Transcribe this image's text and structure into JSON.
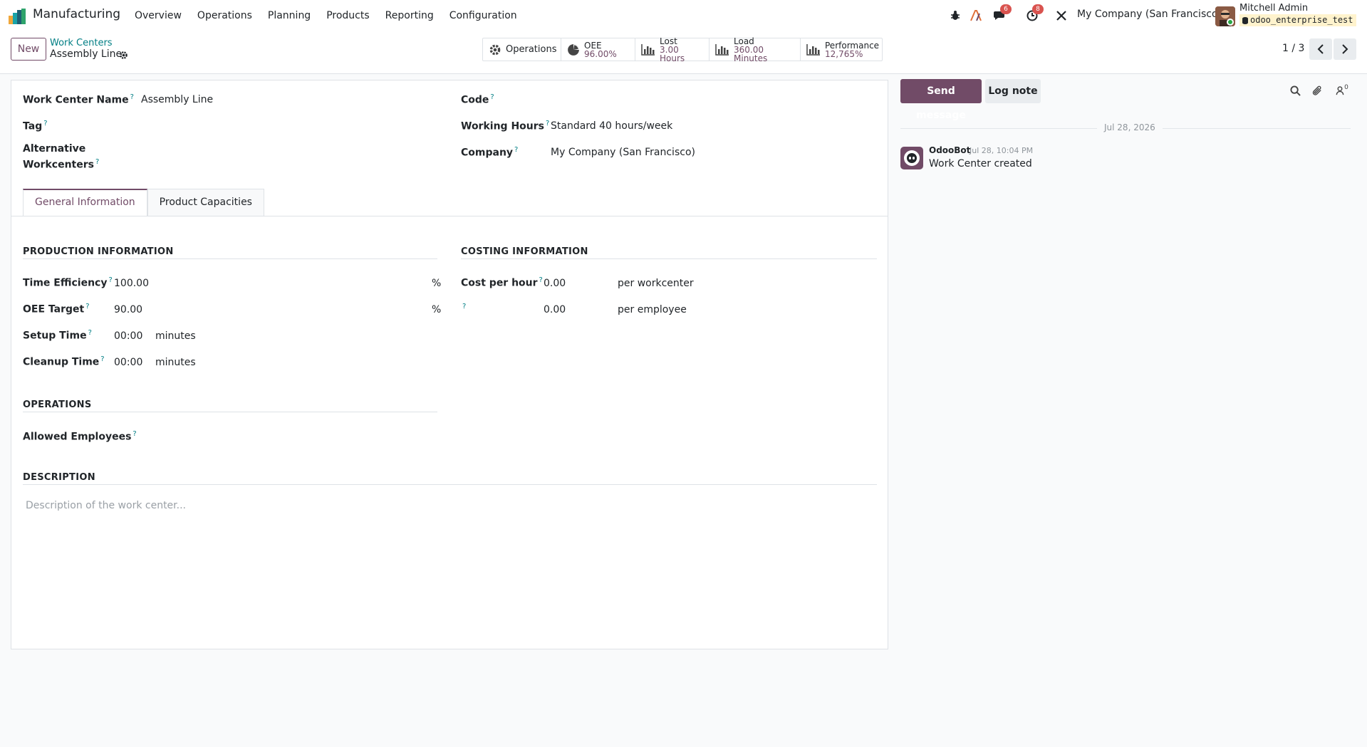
{
  "navbar": {
    "app_name": "Manufacturing",
    "menu": [
      "Overview",
      "Operations",
      "Planning",
      "Products",
      "Reporting",
      "Configuration"
    ],
    "discuss_count": "6",
    "activity_count": "8",
    "company": "My Company (San Francisco)",
    "user_name": "Mitchell Admin",
    "database": "odoo_enterprise_test"
  },
  "breadcrumb": {
    "new_label": "New",
    "parent": "Work Centers",
    "current": "Assembly Line"
  },
  "smart_buttons": {
    "operations": "Operations",
    "oee_label": "OEE",
    "oee_value": "96.00%",
    "lost_label": "Lost",
    "lost_value": "3.00 Hours",
    "load_label": "Load",
    "load_value": "360.00 Minutes",
    "performance_label": "Performance",
    "performance_value": "12,765%"
  },
  "pager": {
    "value": "1 / 3"
  },
  "form": {
    "work_center_name_label": "Work Center Name",
    "work_center_name": "Assembly Line",
    "tag_label": "Tag",
    "alt_workcenters_label_1": "Alternative",
    "alt_workcenters_label_2": "Workcenters",
    "code_label": "Code",
    "working_hours_label": "Working Hours",
    "working_hours": "Standard 40 hours/week",
    "company_label": "Company",
    "company": "My Company (San Francisco)",
    "help_mark": "?"
  },
  "tabs": [
    "General Information",
    "Product Capacities"
  ],
  "production": {
    "title": "PRODUCTION INFORMATION",
    "time_efficiency_label": "Time Efficiency",
    "time_efficiency": "100.00",
    "oee_target_label": "OEE Target",
    "oee_target": "90.00",
    "percent": "%",
    "setup_time_label": "Setup Time",
    "setup_time": "00:00",
    "cleanup_time_label": "Cleanup Time",
    "cleanup_time": "00:00",
    "minutes": "minutes"
  },
  "costing": {
    "title": "COSTING INFORMATION",
    "cost_per_hour_label": "Cost per hour",
    "cost_per_hour": "0.00",
    "per_workcenter": "per workcenter",
    "employee_cost": "0.00",
    "per_employee": "per employee"
  },
  "operations": {
    "title": "OPERATIONS",
    "allowed_employees_label": "Allowed Employees"
  },
  "description": {
    "title": "DESCRIPTION",
    "placeholder": "Description of the work center..."
  },
  "chatter": {
    "send_message": "Send message",
    "log_note": "Log note",
    "followers_count": "0",
    "date": "Jul 28, 2026",
    "author": "OdooBot",
    "time": "Jul 28, 10:04 PM",
    "body": "Work Center created"
  },
  "colors": {
    "brand": "#714b67",
    "link": "#017e84",
    "badge": "#d9534f"
  }
}
